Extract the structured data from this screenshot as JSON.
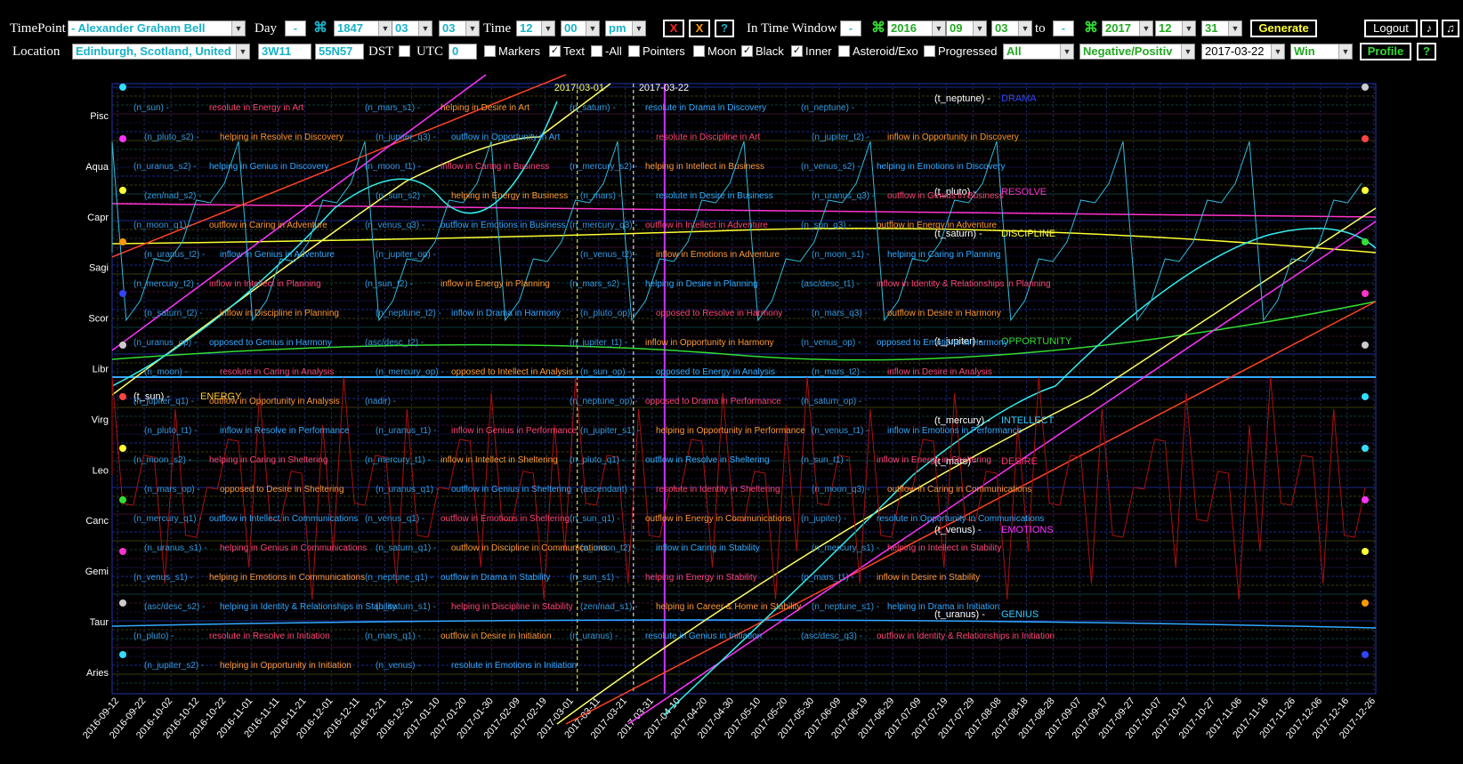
{
  "toolbar1": {
    "timepoint_label": "TimePoint",
    "person": "- Alexander Graham Bell",
    "day_label": "Day",
    "birth_year": "1847",
    "birth_month": "03",
    "birth_day": "03",
    "time_label": "Time",
    "hour": "12",
    "minute": "00",
    "ampm": "pm",
    "x_red": "X",
    "x_orange": "X",
    "help1": "?",
    "window_label": "In Time Window",
    "from_year": "2016",
    "from_month": "09",
    "from_day": "03",
    "to_label": "to",
    "to_year": "2017",
    "to_month": "12",
    "to_day": "31",
    "generate": "Generate",
    "logout": "Logout",
    "note1": "♪",
    "note2": "♫",
    "minus": "-",
    "plus": "+",
    "hash": "⌘"
  },
  "toolbar2": {
    "location_label": "Location",
    "location": "Edinburgh, Scotland, United",
    "longitude": "3W11",
    "latitude": "55N57",
    "dst_label": "DST",
    "utc_label": "UTC",
    "utc_value": "0",
    "checks": [
      {
        "label": "Markers",
        "checked": false
      },
      {
        "label": "Text",
        "checked": true
      },
      {
        "label": "-All",
        "checked": false
      },
      {
        "label": "Pointers",
        "checked": false
      },
      {
        "label": "Moon",
        "checked": false
      },
      {
        "label": "Black",
        "checked": true
      },
      {
        "label": "Inner",
        "checked": true
      },
      {
        "label": "Asteroid/Exo",
        "checked": false
      },
      {
        "label": "Progressed",
        "checked": false
      }
    ],
    "filter_all": "All",
    "polarity": "Negative/Positiv",
    "current_date": "2017-03-22",
    "win": "Win",
    "profile": "Profile",
    "help2": "?"
  },
  "chart_data": {
    "type": "line",
    "signs": [
      "Pisc",
      "Aqua",
      "Capr",
      "Sagi",
      "Scor",
      "Libr",
      "Virg",
      "Leo",
      "Canc",
      "Gemi",
      "Taur",
      "Aries"
    ],
    "x_ticks": [
      "2016-09-12",
      "2016-09-22",
      "2016-10-02",
      "2016-10-12",
      "2016-10-22",
      "2016-11-01",
      "2016-11-11",
      "2016-11-21",
      "2016-12-01",
      "2016-12-11",
      "2016-12-21",
      "2016-12-31",
      "2017-01-10",
      "2017-01-20",
      "2017-01-30",
      "2017-02-09",
      "2017-02-19",
      "2017-03-01",
      "2017-03-11",
      "2017-03-21",
      "2017-03-31",
      "2017-04-10",
      "2017-04-20",
      "2017-04-30",
      "2017-05-10",
      "2017-05-20",
      "2017-05-30",
      "2017-06-09",
      "2017-06-19",
      "2017-06-29",
      "2017-07-09",
      "2017-07-19",
      "2017-07-29",
      "2017-08-08",
      "2017-08-18",
      "2017-08-28",
      "2017-09-07",
      "2017-09-17",
      "2017-09-27",
      "2017-10-07",
      "2017-10-17",
      "2017-10-27",
      "2017-11-06",
      "2017-11-16",
      "2017-11-26",
      "2017-12-06",
      "2017-12-16",
      "2017-12-26"
    ],
    "cursor_labels": [
      "2017-03-01",
      "2017-03-22"
    ],
    "planet_labels": [
      {
        "id": "(t_neptune) -",
        "word": "DRAMA",
        "color": "#3344ff"
      },
      {
        "id": "(t_pluto) -",
        "word": "RESOLVE",
        "color": "#ff33cc"
      },
      {
        "id": "(t_saturn) -",
        "word": "DISCIPLINE",
        "color": "#ffff33"
      },
      {
        "id": "(t_jupiter) -",
        "word": "OPPORTUNITY",
        "color": "#33dd33"
      },
      {
        "id": "(t_sun) -",
        "word": "ENERGY",
        "color": "#ffcc33"
      },
      {
        "id": "(t_mercury) -",
        "word": "INTELLECT",
        "color": "#33ccff"
      },
      {
        "id": "(t_mars) -",
        "word": "DESIRE",
        "color": "#ff3366"
      },
      {
        "id": "(t_venus) -",
        "word": "EMOTIONS",
        "color": "#ff33ff"
      },
      {
        "id": "(t_uranus) -",
        "word": "GENIUS",
        "color": "#33ccff"
      }
    ],
    "aspect_notes": [
      {
        "id": "(n_sun) -",
        "text": "resolute in Energy in Art"
      },
      {
        "id": "(n_mars_s1) -",
        "text": "helping in Desire in Art"
      },
      {
        "id": "(n_saturn) -",
        "text": "resolute in Drama in Discovery"
      },
      {
        "id": "(n_neptune) -",
        "text": ""
      },
      {
        "id": "(n_pluto_s2) -",
        "text": "helping in Resolve in Discovery"
      },
      {
        "id": "(n_jupiter_q3) -",
        "text": "outflow in Opportunity in Art"
      },
      {
        "id": "",
        "text": "resolute in Discipline in Art"
      },
      {
        "id": "(n_jupiter_t2) -",
        "text": "inflow in Opportunity in Discovery"
      },
      {
        "id": "(n_uranus_s2) -",
        "text": "helping in Genius in Discovery"
      },
      {
        "id": "(n_moon_t1) -",
        "text": "inflow in Caring in Business"
      },
      {
        "id": "(n_mercury_s2) -",
        "text": "helping in Intellect in Business"
      },
      {
        "id": "(n_venus_s2) -",
        "text": "helping in Emotions in Discovery"
      },
      {
        "id": "(zen/nad_s2) -",
        "text": ""
      },
      {
        "id": "(n_sun_s2) -",
        "text": "helping in Energy in Business"
      },
      {
        "id": "(n_mars) -",
        "text": "resolute in Desire in Business"
      },
      {
        "id": "(n_uranus_q3) -",
        "text": "outflow in Genius in Business"
      },
      {
        "id": "(n_moon_q1) -",
        "text": "outflow in Caring in Adventure"
      },
      {
        "id": "(n_venus_q3) -",
        "text": "outflow in Emotions in Business"
      },
      {
        "id": "(n_mercury_q3) -",
        "text": "outflow in Intellect in Adventure"
      },
      {
        "id": "(n_sun_q3) -",
        "text": "outflow in Energy in Adventure"
      },
      {
        "id": "(n_uranus_t2) -",
        "text": "inflow in Genius in Adventure"
      },
      {
        "id": "(n_jupiter_op) -",
        "text": ""
      },
      {
        "id": "(n_venus_t2) -",
        "text": "inflow in Emotions in Adventure"
      },
      {
        "id": "(n_moon_s1) -",
        "text": "helping in Caring in Planning"
      },
      {
        "id": "(n_mercury_t2) -",
        "text": "inflow in Intellect in Planning"
      },
      {
        "id": "(n_sun_t2) -",
        "text": "inflow in Energy in Planning"
      },
      {
        "id": "(n_mars_s2) -",
        "text": "helping in Desire in Planning"
      },
      {
        "id": "(asc/desc_t1) -",
        "text": "inflow in Identity & Relationships in Planning"
      },
      {
        "id": "(n_saturn_t2) -",
        "text": "inflow in Discipline in Planning"
      },
      {
        "id": "(n_neptune_t2) -",
        "text": "inflow in Drama in Harmony"
      },
      {
        "id": "(n_pluto_op) -",
        "text": "opposed to Resolve in Harmony"
      },
      {
        "id": "(n_mars_q3) -",
        "text": "outflow in Desire in Harmony"
      },
      {
        "id": "(n_uranus_op) -",
        "text": "opposed to Genius in Harmony"
      },
      {
        "id": "(asc/desc_t2) -",
        "text": ""
      },
      {
        "id": "(n_jupiter_t1) -",
        "text": "inflow in Opportunity in Harmony"
      },
      {
        "id": "(n_venus_op) -",
        "text": "opposed to Emotions in Harmony"
      },
      {
        "id": "(n_moon) -",
        "text": "resolute in Caring in Analysis"
      },
      {
        "id": "(n_mercury_op) -",
        "text": "opposed to Intellect in Analysis"
      },
      {
        "id": "(n_sun_op) -",
        "text": "opposed to Energy in Analysis"
      },
      {
        "id": "(n_mars_t2) -",
        "text": "inflow in Desire in Analysis"
      },
      {
        "id": "(n_jupiter_q1) -",
        "text": "outflow in Opportunity in Analysis"
      },
      {
        "id": "(nadir) -",
        "text": ""
      },
      {
        "id": "(n_neptune_op) -",
        "text": "opposed to Drama in Performance"
      },
      {
        "id": "(n_saturn_op) -",
        "text": ""
      },
      {
        "id": "(n_pluto_t1) -",
        "text": "inflow in Resolve in Performance"
      },
      {
        "id": "(n_uranus_t1) -",
        "text": "inflow in Genius in Performance"
      },
      {
        "id": "(n_jupiter_s1) -",
        "text": "helping in Opportunity in Performance"
      },
      {
        "id": "(n_venus_t1) -",
        "text": "inflow in Emotions in Performance"
      },
      {
        "id": "(n_moon_s2) -",
        "text": "helping in Caring in Sheltering"
      },
      {
        "id": "(n_mercury_t1) -",
        "text": "inflow in Intellect in Sheltering"
      },
      {
        "id": "(n_pluto_q1) -",
        "text": "outflow in Resolve in Sheltering"
      },
      {
        "id": "(n_sun_t1) -",
        "text": "inflow in Energy in Sheltering"
      },
      {
        "id": "(n_mars_op) -",
        "text": "opposed to Desire in Sheltering"
      },
      {
        "id": "(n_uranus_q1) -",
        "text": "outflow in Genius in Sheltering"
      },
      {
        "id": "(ascendant) -",
        "text": "resolute in Identity in Sheltering"
      },
      {
        "id": "(n_moon_q3) -",
        "text": "outflow in Caring in Communications"
      },
      {
        "id": "(n_mercury_q1) -",
        "text": "outflow in Intellect in Communications"
      },
      {
        "id": "(n_venus_q1) -",
        "text": "outflow in Emotions in Sheltering"
      },
      {
        "id": "(n_sun_q1) -",
        "text": "outflow in Energy in Communications"
      },
      {
        "id": "(n_jupiter) -",
        "text": "resolute in Opportunity in Communications"
      },
      {
        "id": "(n_uranus_s1) -",
        "text": "helping in Genius in Communications"
      },
      {
        "id": "(n_saturn_q1) -",
        "text": "outflow in Discipline in Communications"
      },
      {
        "id": "(n_moon_t2) -",
        "text": "inflow in Caring in Stability"
      },
      {
        "id": "(n_mercury_s1) -",
        "text": "helping in Intellect in Stability"
      },
      {
        "id": "(n_venus_s1) -",
        "text": "helping in Emotions in Communications"
      },
      {
        "id": "(n_neptune_q1) -",
        "text": "outflow in Drama in Stability"
      },
      {
        "id": "(n_sun_s1) -",
        "text": "helping in Energy in Stability"
      },
      {
        "id": "(n_mars_t1) -",
        "text": "inflow in Desire in Stability"
      },
      {
        "id": "(asc/desc_s2) -",
        "text": "helping in Identity & Relationships in Stability"
      },
      {
        "id": "(n_saturn_s1) -",
        "text": "helping in Discipline in Stability"
      },
      {
        "id": "(zen/nad_s1) -",
        "text": "helping in Career & Home in Stability"
      },
      {
        "id": "(n_neptune_s1) -",
        "text": "helping in Drama in Initiation"
      },
      {
        "id": "(n_pluto) -",
        "text": "resolute in Resolve in Initiation"
      },
      {
        "id": "(n_mars_q1) -",
        "text": "outflow in Desire in Initiation"
      },
      {
        "id": "(n_uranus) -",
        "text": "resolute in Genius in Initiation"
      },
      {
        "id": "(asc/desc_q3) -",
        "text": "outflow in Identity & Relationships in Initiation"
      },
      {
        "id": "(n_jupiter_s2) -",
        "text": "helping in Opportunity in Initiation"
      },
      {
        "id": "(n_venus) -",
        "text": "resolute in Emotions in Initiation"
      }
    ]
  }
}
